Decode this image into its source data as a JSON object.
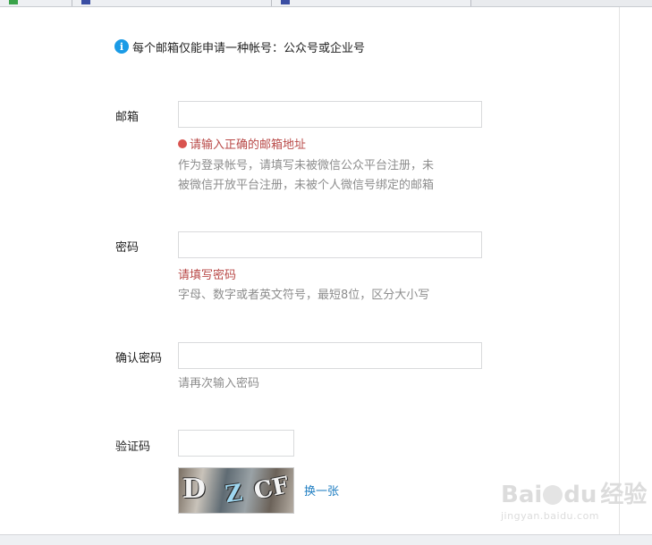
{
  "notice": {
    "text": "每个邮箱仅能申请一种帐号：公众号或企业号",
    "icon": "info-icon"
  },
  "email": {
    "label": "邮箱",
    "value": "",
    "error": "请输入正确的邮箱地址",
    "hint_line1": "作为登录帐号，请填写未被微信公众平台注册，未",
    "hint_line2": "被微信开放平台注册，未被个人微信号绑定的邮箱"
  },
  "password": {
    "label": "密码",
    "value": "",
    "error": "请填写密码",
    "hint": "字母、数字或者英文符号，最短8位，区分大小写"
  },
  "confirm_password": {
    "label": "确认密码",
    "value": "",
    "hint": "请再次输入密码"
  },
  "captcha": {
    "label": "验证码",
    "value": "",
    "image_text": "D CF",
    "refresh_label": "换一张"
  },
  "watermark": {
    "brand": "Bai",
    "brand2": "du",
    "cn": "经验",
    "url": "jingyan.baidu.com"
  },
  "colors": {
    "error": "#b94a48",
    "link": "#1f7ec2",
    "info": "#1a9be6",
    "hint": "#8d8d8d"
  }
}
